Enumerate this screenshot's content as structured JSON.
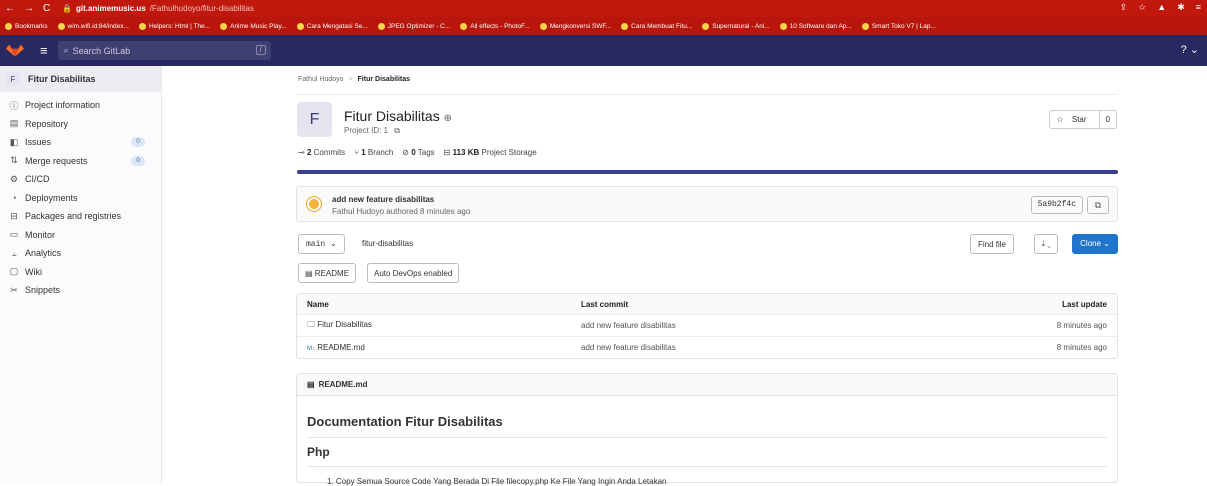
{
  "browser": {
    "nav_icons": [
      "back-icon",
      "forward-icon",
      "reload-icon"
    ],
    "url_host": "git.animemusic.us",
    "url_path": "/Fathulhudoyo/fitur-disabilitas",
    "bookmarks": [
      "Bookmarks",
      "wim.wifi.id:84/index...",
      "Helpers: Html | The...",
      "Anime Music Play...",
      "Cara Mengatasi Se...",
      "JPEG Optimizer - C...",
      "All effects - PhotoF...",
      "Mengkonversi SWF...",
      "Cara Membuat Fitu...",
      "Supernatural - Ani...",
      "10 Software dan Ap...",
      "Smart Toko V7 | Lap..."
    ]
  },
  "header": {
    "search_placeholder": "Search GitLab",
    "search_shortcut": "/",
    "help_label": "?"
  },
  "sidebar": {
    "project_initial": "F",
    "project_name": "Fitur Disabilitas",
    "items": [
      {
        "label": "Project information",
        "icon": "info-icon"
      },
      {
        "label": "Repository",
        "icon": "doc-icon"
      },
      {
        "label": "Issues",
        "icon": "issues-icon",
        "badge": "0"
      },
      {
        "label": "Merge requests",
        "icon": "merge-icon",
        "badge": "0"
      },
      {
        "label": "CI/CD",
        "icon": "rocket-icon"
      },
      {
        "label": "Deployments",
        "icon": "deploy-icon"
      },
      {
        "label": "Packages and registries",
        "icon": "package-icon"
      },
      {
        "label": "Monitor",
        "icon": "monitor-icon"
      },
      {
        "label": "Analytics",
        "icon": "analytics-icon"
      },
      {
        "label": "Wiki",
        "icon": "wiki-icon"
      },
      {
        "label": "Snippets",
        "icon": "snippets-icon"
      }
    ]
  },
  "breadcrumb": {
    "owner": "Fathul Hudoyo",
    "separator": ">",
    "project": "Fitur Disabilitas"
  },
  "project": {
    "initial": "F",
    "title": "Fitur Disabilitas",
    "id_label": "Project ID: 1",
    "star_label": "Star",
    "star_count": "0",
    "stats": {
      "commits_num": "2",
      "commits_label": "Commits",
      "branch_num": "1",
      "branch_label": "Branch",
      "tags_num": "0",
      "tags_label": "Tags",
      "storage_num": "113 KB",
      "storage_label": "Project Storage"
    },
    "storage_progress": 1.0
  },
  "last_commit": {
    "title": "add new feature disabilitas",
    "meta": "Fathul Hudoyo authored 8 minutes ago",
    "sha": "5a9b2f4c"
  },
  "repo_bar": {
    "branch": "main",
    "path": "fitur-disabilitas",
    "find_file": "Find file",
    "clone": "Clone",
    "readme_btn": "README",
    "autodevops_btn": "Auto DevOps enabled"
  },
  "file_table": {
    "headers": {
      "name": "Name",
      "commit": "Last commit",
      "update": "Last update"
    },
    "rows": [
      {
        "name": "Fitur Disabilitas",
        "icon": "folder-icon",
        "commit": "add new feature disabilitas",
        "update": "8 minutes ago"
      },
      {
        "name": "README.md",
        "icon": "markdown-icon",
        "commit": "add new feature disabilitas",
        "update": "8 minutes ago"
      }
    ]
  },
  "readme": {
    "filename": "README.md",
    "title": "Documentation Fitur Disabilitas",
    "subtitle": "Php",
    "first_item": "1. Copy Semua Source Code Yang Berada Di File filecopy.php Ke File Yang Ingin Anda Letakan"
  }
}
